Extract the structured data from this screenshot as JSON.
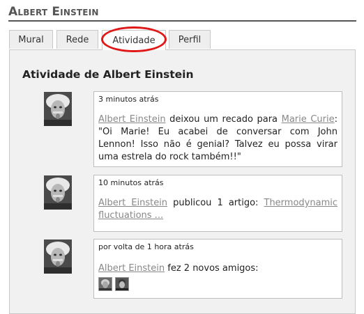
{
  "header": {
    "title": "Albert Einstein"
  },
  "tabs": [
    {
      "label": "Mural"
    },
    {
      "label": "Rede"
    },
    {
      "label": "Atividade"
    },
    {
      "label": "Perfil"
    }
  ],
  "main": {
    "section_title": "Atividade de Albert Einstein",
    "activities": [
      {
        "time": "3 minutos atrás",
        "actor": "Albert Einstein",
        "text1": " deixou um recado para ",
        "target": "Marie Curie",
        "text2": ": \"Oi Marie! Eu acabei de conversar com John Lennon! Isso não é genial? Talvez eu possa virar uma estrela do rock também!!\""
      },
      {
        "time": "10 minutos atrás",
        "actor": "Albert Einstein",
        "text1": " publicou 1 artigo: ",
        "target": "Thermodynamic fluctuations ..."
      },
      {
        "time": "por volta de 1 hora atrás",
        "actor": "Albert Einstein",
        "text1": " fez 2 novos amigos:"
      }
    ]
  },
  "colors": {
    "highlight": "#e01818",
    "link": "#888888",
    "panel_bg": "#f1f1f1"
  }
}
